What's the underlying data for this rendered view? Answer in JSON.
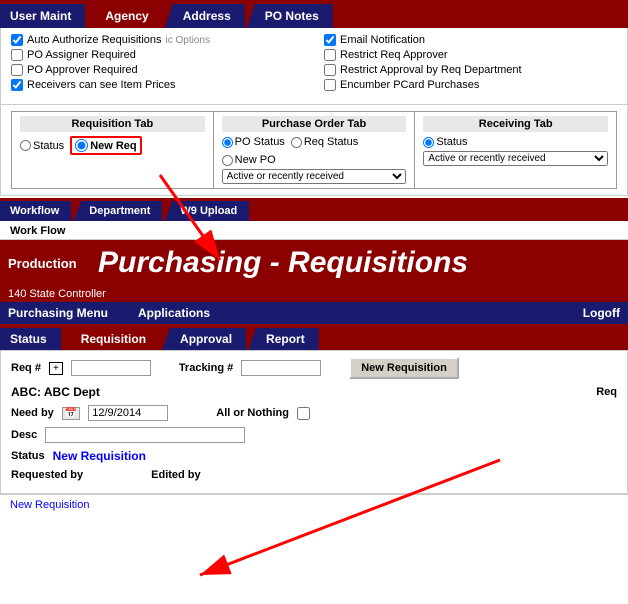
{
  "topNav": {
    "tabs": [
      "User Maint",
      "Agency",
      "Address",
      "PO Notes"
    ]
  },
  "checkboxes": {
    "left": [
      {
        "label": "Auto Authorize Requisitions",
        "checked": true
      },
      {
        "label": "PO Assigner Required",
        "checked": false
      },
      {
        "label": "PO Approver Required",
        "checked": false
      },
      {
        "label": "Receivers can see Item Prices",
        "checked": true
      }
    ],
    "right": [
      {
        "label": "Email Notification",
        "checked": true
      },
      {
        "label": "Restrict Req Approver",
        "checked": false
      },
      {
        "label": "Restrict Approval by Req Department",
        "checked": false
      },
      {
        "label": "Encumber PCard Purchases",
        "checked": false
      }
    ]
  },
  "tabOptions": {
    "requisition": {
      "header": "Requisition Tab",
      "options": [
        "Status",
        "New Req"
      ],
      "selected": "New Req"
    },
    "purchaseOrder": {
      "header": "Purchase Order Tab",
      "options": [
        "PO Status",
        "Req Status",
        "New PO"
      ],
      "selected": "PO Status",
      "dropdown": "Active or recently received"
    },
    "receiving": {
      "header": "Receiving Tab",
      "options": [
        "Status"
      ],
      "selected": "Status",
      "dropdown": "Active or recently received"
    }
  },
  "secondNav": {
    "workflow_label": "Work Flow",
    "tabs": [
      "Workflow",
      "Department",
      "W9 Upload"
    ]
  },
  "production": {
    "label": "Production",
    "title": "Purchasing - Requisitions",
    "stateController": "140 State Controller"
  },
  "menuBar": {
    "items": [
      "Purchasing Menu",
      "Applications",
      "Logoff"
    ]
  },
  "tabBar": {
    "tabs": [
      "Status",
      "Requisition",
      "Approval",
      "Report"
    ]
  },
  "form": {
    "reqLabel": "Req #",
    "trackingLabel": "Tracking #",
    "newReqButton": "New Requisition",
    "deptLabel": "ABC: ABC Dept",
    "needByLabel": "Need by",
    "needByDate": "12/9/2014",
    "allOrNothingLabel": "All or Nothing",
    "descLabel": "Desc",
    "statusLabel": "Status",
    "statusValue": "New Requisition",
    "requestedByLabel": "Requested by",
    "editedByLabel": "Edited by",
    "reqLabel2": "Req"
  },
  "bottomBar": {
    "newReqLabel": "New Requisition"
  }
}
